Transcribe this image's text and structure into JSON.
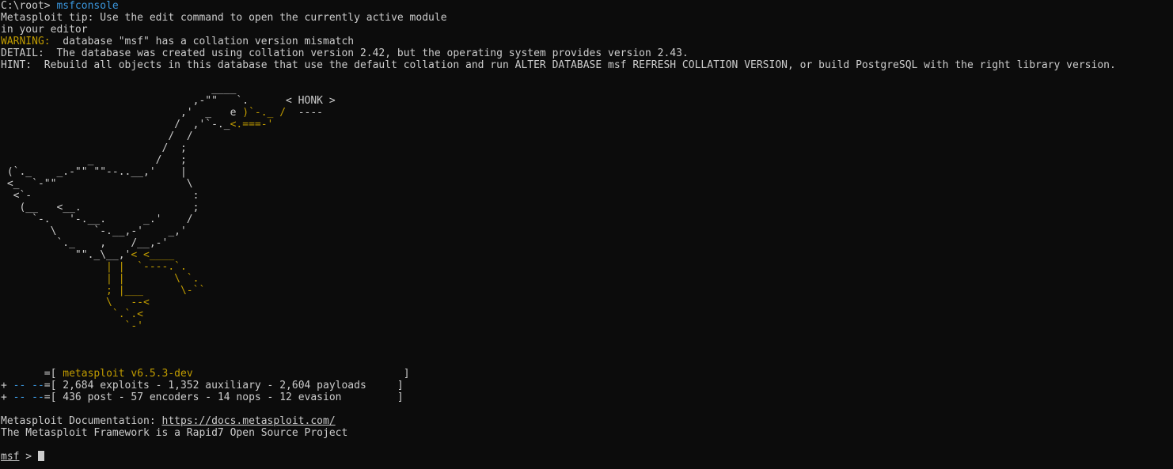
{
  "theme": {
    "background": "#0c0c0c",
    "text": "#cccccc",
    "accent_cyan": "#3a96dd",
    "accent_yellow": "#c19c00"
  },
  "header": {
    "prompt": "C:\\root> ",
    "command": "msfconsole",
    "tip_line1": "Metasploit tip: Use the edit command to open the currently active module",
    "tip_line2": "in your editor",
    "warning_label": "WARNING:",
    "warning_text": "  database \"msf\" has a collation version mismatch",
    "detail_text": "DETAIL:  The database was created using collation version 2.42, but the operating system provides version 2.43.",
    "hint_text": "HINT:  Rebuild all objects in this database that use the default collation and run ALTER DATABASE msf REFRESH COLLATION VERSION, or build PostgreSQL with the right library version."
  },
  "banner": {
    "l01_w": "                                  ____",
    "l02_w": "                               ,-\"\"   `.      < HONK >",
    "l03_w": "                             ,'  _   e ",
    "l03_y": ")`-._ /",
    "l03_w2": "  ----",
    "l04_w": "                            /  ,'`-._",
    "l04_y": "<.===-'",
    "l05_w": "                           /  /",
    "l06_w": "                          /  ;",
    "l07_w": "              _          /   ;",
    "l08_w": " (`._    _.-\"\" \"\"--..__,'    |",
    "l09_w": " <_  `-\"\"                     \\",
    "l10_w": "  <`-                          :",
    "l11_w": "   (__   <__.                  ;",
    "l12_w": "     `-.   '-.__.      _.'    /",
    "l13_w": "        \\      `-.__,-'    _,'",
    "l14_w": "         `._    ,    /__,-'",
    "l15_w": "            \"\"._\\__,'",
    "l15_y": "< <____",
    "l16_y": "                 | |  `----.`.",
    "l17_y": "                 | |        \\ `.",
    "l18_y": "                 ; |___      \\-``",
    "l19_y": "                 \\   --<",
    "l20_y": "                  `.`.<",
    "l21_y": "                    `-'"
  },
  "version_block": {
    "v1_pre": "       =[ ",
    "v1_name": "metasploit v6.5.3-dev",
    "v1_post": "                                  ]",
    "v2_plus": "+ ",
    "v2_dash": "-- --",
    "v2_text": "=[ 2,684 exploits - 1,352 auxiliary - 2,604 payloads     ]",
    "v3_plus": "+ ",
    "v3_dash": "-- --",
    "v3_text": "=[ 436 post - 57 encoders - 14 nops - 12 evasion         ]"
  },
  "footer": {
    "docs_label": "Metasploit Documentation: ",
    "docs_link": "https://docs.metasploit.com/",
    "framework_line": "The Metasploit Framework is a Rapid7 Open Source Project"
  },
  "prompt": {
    "name": "msf",
    "sep": " > "
  }
}
